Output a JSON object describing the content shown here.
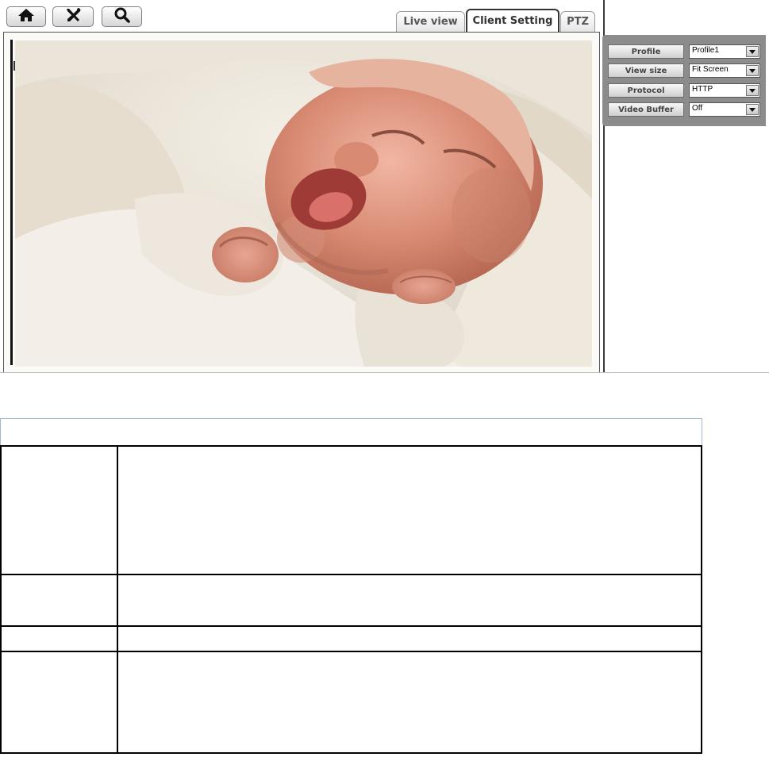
{
  "toolbar": {
    "buttons": [
      {
        "icon": "home-icon"
      },
      {
        "icon": "tools-icon"
      },
      {
        "icon": "search-icon"
      }
    ]
  },
  "tabs": [
    {
      "label": "Live view",
      "active": false
    },
    {
      "label": "Client Setting",
      "active": true
    },
    {
      "label": "PTZ",
      "active": false
    }
  ],
  "video": {
    "icon": "camera-feed-image"
  },
  "settings": [
    {
      "label": "Profile",
      "value": "Profile1"
    },
    {
      "label": "View size",
      "value": "Fit Screen"
    },
    {
      "label": "Protocol",
      "value": "HTTP"
    },
    {
      "label": "Video Buffer",
      "value": "Off"
    }
  ],
  "colors": {
    "panel_bg": "#8c8c8c",
    "table_header_border": "#9fb7d3"
  }
}
